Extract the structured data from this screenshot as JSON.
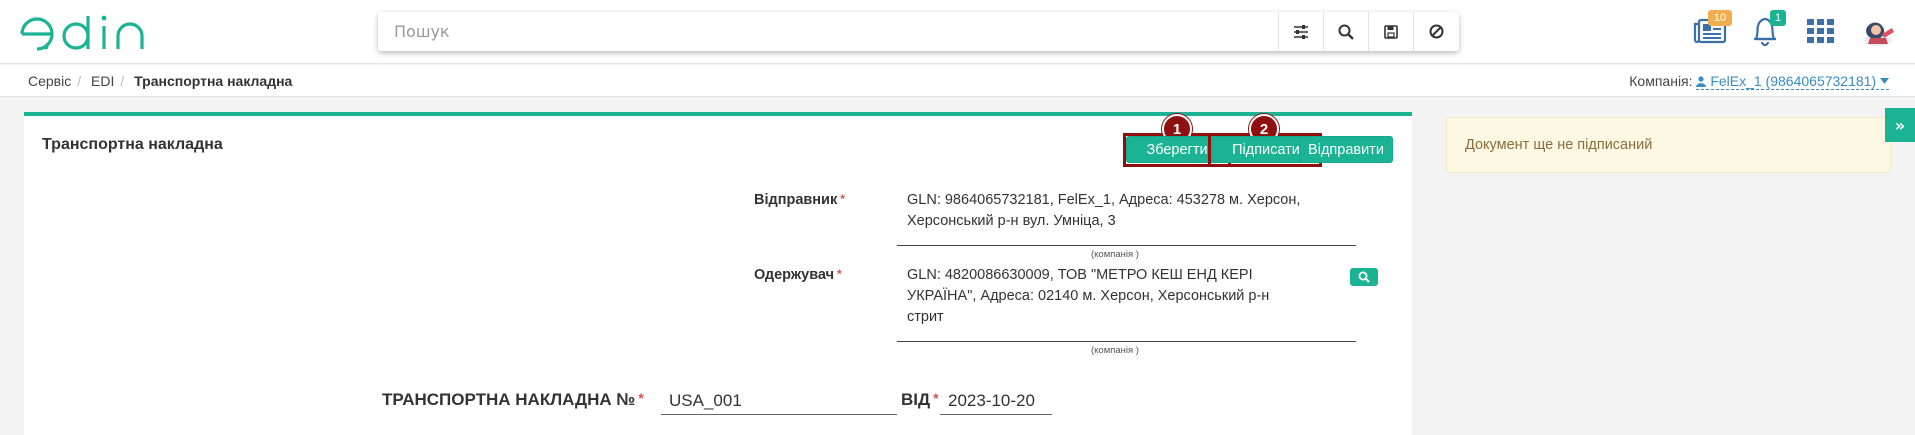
{
  "app": {
    "logo_text": "edin"
  },
  "search": {
    "placeholder": "Пошук"
  },
  "header": {
    "news_badge": "10",
    "notifications_badge": "1",
    "colors": {
      "accent": "#1ab394",
      "news_badge": "#f0ad4e",
      "notif_badge": "#1ab394"
    }
  },
  "breadcrumb": {
    "items": [
      "Сервіс",
      "EDI",
      "Транспортна накладна"
    ]
  },
  "company": {
    "label": "Компанія:",
    "value": "FelEx_1 (9864065732181)"
  },
  "document": {
    "title": "Транспортна накладна",
    "buttons": {
      "save": "Зберегти",
      "sign": "Підписати",
      "send": "Відправити"
    },
    "markers": {
      "save": "1",
      "sign": "2"
    },
    "sender": {
      "label": "Відправник",
      "line1": "GLN: 9864065732181, FelEx_1, Адреса: 453278 м. Херсон,",
      "line2": "Херсонський р-н вул. Умніца, 3",
      "hint": "(компанія )"
    },
    "receiver": {
      "label": "Одержувач",
      "line1": "GLN: 4820086630009, ТОВ \"МЕТРО КЕШ ЕНД КЕРІ",
      "line2": "УКРАЇНА\", Адреса: 02140 м. Херсон, Херсонський р-н",
      "line3": "стрит",
      "hint": "(компанія )"
    },
    "number": {
      "label": "ТРАНСПОРТНА НАКЛАДНА №",
      "value": "USA_001"
    },
    "date": {
      "label": "ВІД",
      "value": "2023-10-20"
    },
    "required_mark": "*"
  },
  "status": {
    "message": "Документ ще не підписаний"
  },
  "side_toggle": {
    "symbol": "»"
  }
}
